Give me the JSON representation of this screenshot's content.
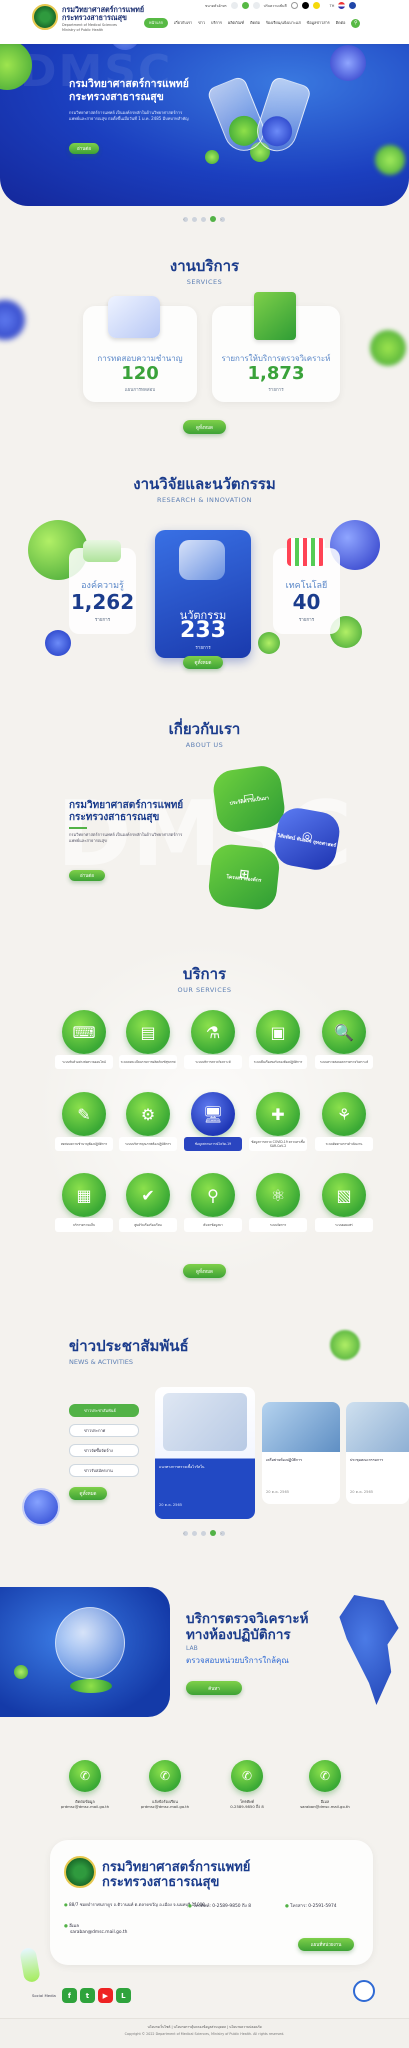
{
  "header": {
    "org_th_1": "กรมวิทยาศาสตร์การแพทย์",
    "org_th_2": "กระทรวงสาธารณสุข",
    "org_en_1": "Department of Medical Sciences",
    "org_en_2": "Ministry of Public Health",
    "topbar": [
      "ขนาดตัวอักษร",
      "ก",
      "ก",
      "ก",
      "ปรับความเข้มสี",
      "C",
      "C",
      "C"
    ],
    "nav": [
      "หน้าแรก",
      "เกี่ยวกับเรา",
      "ข่าว",
      "บริการ",
      "ผลิตภัณฑ์",
      "ติดต่อ",
      "ร้องเรียน/แจ้งเบาะแส",
      "ข้อมูลข่าวสาร",
      "ติดต่อ"
    ],
    "nav_active": "หน้าแรก"
  },
  "hero": {
    "watermark": "DMSC",
    "title_1": "กรมวิทยาศาสตร์การแพทย์",
    "title_2": "กระทรวงสาธารณสุข",
    "desc": "กรมวิทยาศาสตร์การแพทย์ เป็นองค์กรหลักในด้านวิทยาศาสตร์การแพทย์และสาธารณสุข ก่อตั้งขึ้นเมื่อวันที่ 1 ม.ค. 2485 มีบทบาทสำคัญ",
    "button": "อ่านต่อ",
    "slide_count": 3,
    "slide_active": 2
  },
  "services_summary": {
    "heading_th": "งานบริการ",
    "heading_en": "SERVICES",
    "cards": [
      {
        "label": "การทดสอบความชำนาญ",
        "value": "120",
        "unit": "แผนการทดสอบ"
      },
      {
        "label": "รายการให้บริการตรวจวิเคราะห์",
        "value": "1,873",
        "unit": "รายการ"
      }
    ],
    "button": "ดูทั้งหมด"
  },
  "research": {
    "heading_th": "งานวิจัยและนวัตกรรม",
    "heading_en": "RESEARCH & INNOVATION",
    "cards": [
      {
        "label": "องค์ความรู้",
        "value": "1,262",
        "unit": "รายการ"
      },
      {
        "label": "นวัตกรรม",
        "value": "233",
        "unit": "รายการ"
      },
      {
        "label": "เทคโนโลยี",
        "value": "40",
        "unit": "รายการ"
      }
    ],
    "button": "ดูทั้งหมด"
  },
  "about": {
    "heading_th": "เกี่ยวกับเรา",
    "heading_en": "ABOUT US",
    "watermark": "DMSC",
    "title_1": "กรมวิทยาศาสตร์การแพทย์",
    "title_2": "กระทรวงสาธารณสุข",
    "desc": "กรมวิทยาศาสตร์การแพทย์ เป็นองค์กรหลักในด้านวิทยาศาสตร์การแพทย์และสาธารณสุข",
    "button": "อ่านต่อ",
    "tiles": [
      "ประวัติความเป็นมา",
      "วิสัยทัศน์ พันธกิจ ยุทธศาสตร์",
      "โครงสร้างองค์กร"
    ]
  },
  "services": {
    "heading_th": "บริการ",
    "heading_en": "OUR SERVICES",
    "items": [
      {
        "label": "ระบบรับตัวอย่างส่งตรวจออนไลน์",
        "icon": "⌨"
      },
      {
        "label": "ระบบลงทะเบียนรายการผลิตภัณฑ์สุขภาพ",
        "icon": "▤"
      },
      {
        "label": "ระบบบริการตรวจวิเคราะห์",
        "icon": "⚗"
      },
      {
        "label": "ระบบยื่นเรื่องขอรับรองห้องปฏิบัติการ",
        "icon": "▣"
      },
      {
        "label": "ระบบตรวจสอบผลการตรวจวิเคราะห์",
        "icon": "🔍"
      },
      {
        "label": "ทดสอบความชำนาญห้องปฏิบัติการ",
        "icon": "✎"
      },
      {
        "label": "ระบบบริหารคุณภาพห้องปฏิบัติการ",
        "icon": "⚙"
      },
      {
        "label": "ข้อมูลสถานการณ์โควิด-19",
        "icon": "🖥"
      },
      {
        "label": "ข้อมูลการตรวจ COVID-19 ตรวจหาเชื้อ SAR-CoV-2",
        "icon": "✚"
      },
      {
        "label": "ระบบติดตามการดำเนินงาน",
        "icon": "⚘"
      },
      {
        "label": "บริการตรวจแล็บ",
        "icon": "▦"
      },
      {
        "label": "ศูนย์รับเรื่องร้องเรียน",
        "icon": "✔"
      },
      {
        "label": "ค้นหาข้อมูลยา",
        "icon": "⚲"
      },
      {
        "label": "ระบบจัดการ",
        "icon": "⚛"
      },
      {
        "label": "ระบบเผยแพร่",
        "icon": "▧"
      }
    ],
    "highlight_index": 7,
    "button": "ดูทั้งหมด"
  },
  "news": {
    "heading_th": "ข่าวประชาสัมพันธ์",
    "heading_en": "NEWS & ACTIVITIES",
    "tabs": [
      "ข่าวประชาสัมพันธ์",
      "ข่าวประกาศ",
      "ข่าวจัดซื้อจัดจ้าง",
      "ข่าวรับสมัครงาน"
    ],
    "active_tab": "ข่าวประชาสัมพันธ์",
    "button": "ดูทั้งหมด",
    "cards": [
      {
        "title": "แนวทางการตรวจเชื้อไวรัสใน",
        "date": "20 ต.ค. 2565"
      },
      {
        "title": "เครือข่ายห้องปฏิบัติการ",
        "date": "20 ต.ค. 2565"
      },
      {
        "title": "ประชุมคณะกรรมการ",
        "date": "20 ต.ค. 2565"
      }
    ],
    "slide_count": 3,
    "slide_active": 2
  },
  "lab": {
    "title_1": "บริการตรวจวิเคราะห์",
    "title_2": "ทางห้องปฏิบัติการ",
    "sub_en": "LAB",
    "sub_th": "ตรวจสอบหน่วยบริการใกล้คุณ",
    "button": "ค้นหา"
  },
  "contact": {
    "items": [
      {
        "title": "ติดต่อข้อมูล",
        "value": "prdmsc@dmsc.mail.go.th"
      },
      {
        "title": "แจ้งข้อร้องเรียน",
        "value": "prdmsc@dmsc.mail.go.th"
      },
      {
        "title": "โทรศัพท์",
        "value": "0-2589-9850 ถึง 8"
      },
      {
        "title": "อีเมล",
        "value": "saraban@dmsc.mail.go.th"
      }
    ],
    "org_1": "กรมวิทยาศาสตร์การแพทย์",
    "org_2": "กระทรวงสาธารณสุข",
    "address": "88/7 ซอยบำราศนราดูร ถ.ติวานนท์ ต.ตลาดขวัญ อ.เมือง จ.นนทบุรี 11000",
    "phone": "โทรศัพท์: 0-2589-9850 ถึง 8",
    "fax": "โทรสาร: 0-2591-5974",
    "email_label": "อีเมล",
    "email": "saraban@dmsc.mail.go.th",
    "map_button": "แผนที่หน่วยงาน",
    "social_label": "Social Media",
    "social": [
      "f",
      "t",
      "▶",
      "L"
    ]
  },
  "footer": {
    "links": "นโยบายเว็บไซต์ | นโยบายการคุ้มครองข้อมูลส่วนบุคคล | นโยบายความปลอดภัย",
    "copyright": "Copyright © 2022 Department of Medical Sciences, Ministry of Public Health. All rights reserved."
  },
  "colors": {
    "brand_blue": "#1b3c8c",
    "brand_green": "#52b246",
    "hero_blue": "#1b3fbf"
  }
}
